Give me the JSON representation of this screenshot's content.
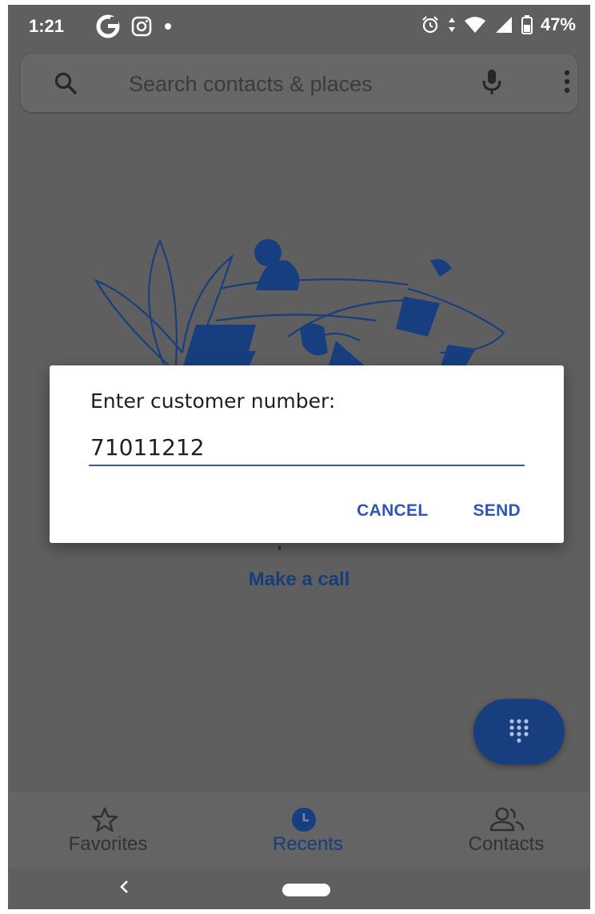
{
  "status_bar": {
    "time": "1:21",
    "battery": "47%",
    "left_icons": [
      "g-app-icon",
      "instagram-icon",
      "dot-icon"
    ],
    "right_icons": [
      "alarm-icon",
      "data-arrows-icon",
      "wifi-icon",
      "signal-icon",
      "battery-icon"
    ]
  },
  "search": {
    "placeholder": "Search contacts & places"
  },
  "empty_state": {
    "make_call": "Make a call"
  },
  "dialog": {
    "title": "Enter customer number:",
    "input_value": "71011212",
    "cancel_label": "CANCEL",
    "send_label": "SEND"
  },
  "bottom_nav": {
    "items": [
      {
        "label": "Favorites",
        "icon": "star-icon"
      },
      {
        "label": "Recents",
        "icon": "clock-icon",
        "active": true
      },
      {
        "label": "Contacts",
        "icon": "contacts-icon"
      }
    ]
  },
  "colors": {
    "accent": "#2e55b8",
    "scrim_background": "#5f5f5f",
    "fab": "#173f80"
  }
}
